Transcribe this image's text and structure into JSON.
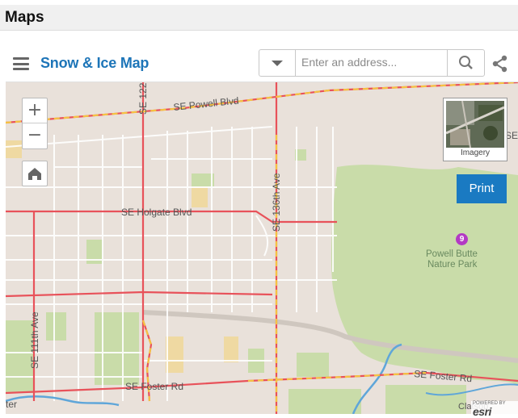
{
  "page": {
    "title": "Maps"
  },
  "toolbar": {
    "menu_icon": "hamburger-menu-icon",
    "title": "Snow & Ice Map",
    "search_placeholder": "Enter an address...",
    "search_value": "",
    "dropdown_icon": "chevron-down-icon",
    "search_icon": "magnifier-icon",
    "share_icon": "share-icon"
  },
  "map_controls": {
    "zoom_in": "+",
    "zoom_out": "−",
    "home_icon": "home-icon",
    "basemap_label": "Imagery",
    "print_label": "Print"
  },
  "map_labels": {
    "powell_blvd": "SE Powell Blvd",
    "holgate_blvd": "SE Holgate Blvd",
    "ave_136": "SE 136th Ave",
    "ave_122": "SE 122",
    "ave_111": "SE 111th Ave",
    "foster_rd_west": "SE Foster Rd",
    "foster_rd_east": "SE Foster Rd",
    "edge_se": "SE",
    "edge_ter": "ter",
    "clatsop": "Clatsop",
    "park_line1": "Powell Butte",
    "park_line2": "Nature Park",
    "poi_number": "9"
  },
  "attribution": {
    "powered_by": "POWERED BY",
    "esri": "esri"
  },
  "colors": {
    "primary_road": "#e8525a",
    "snow_route": "#f5c342",
    "park": "#c9dca9",
    "land": "#e9e1da",
    "water": "#5fa6d9",
    "accent": "#1a7ac2",
    "poi": "#b33ac4"
  }
}
